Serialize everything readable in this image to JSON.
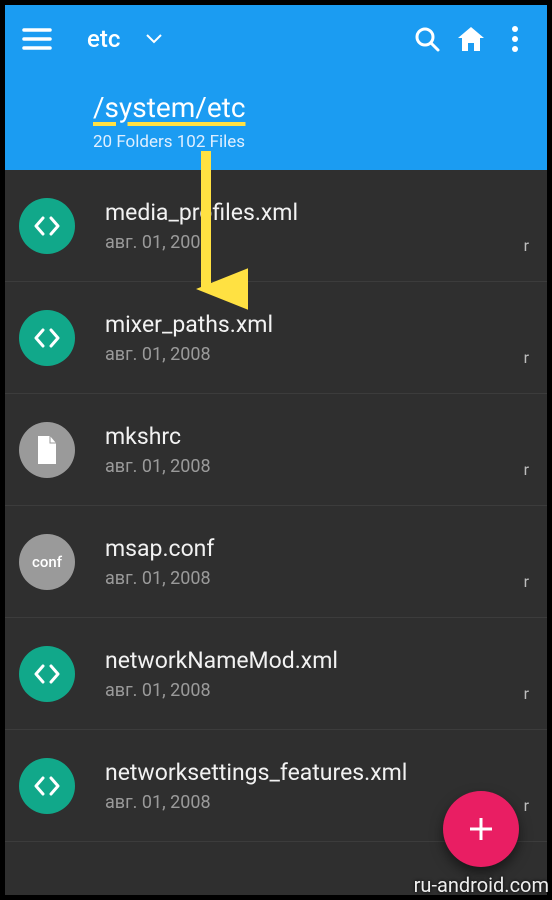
{
  "colors": {
    "accent": "#1b9cf2",
    "teal": "#11a88a",
    "grey": "#9a9a9a",
    "fab": "#e91e63",
    "arrow": "#ffe142"
  },
  "toolbar": {
    "title": "etc"
  },
  "path": {
    "text": "/system/etc",
    "counts": "20 Folders 102 Files"
  },
  "files": [
    {
      "name": "media_profiles.xml",
      "date": "авг. 01, 2008",
      "perm": "r",
      "icon": "code"
    },
    {
      "name": "mixer_paths.xml",
      "date": "авг. 01, 2008",
      "perm": "r",
      "icon": "code"
    },
    {
      "name": "mkshrc",
      "date": "авг. 01, 2008",
      "perm": "r",
      "icon": "file"
    },
    {
      "name": "msap.conf",
      "date": "авг. 01, 2008",
      "perm": "r",
      "icon": "conf"
    },
    {
      "name": "networkNameMod.xml",
      "date": "авг. 01, 2008",
      "perm": "r",
      "icon": "code"
    },
    {
      "name": "networksettings_features.xml",
      "date": "авг. 01, 2008",
      "perm": "r",
      "icon": "code"
    }
  ],
  "watermark": "ru-android.com"
}
